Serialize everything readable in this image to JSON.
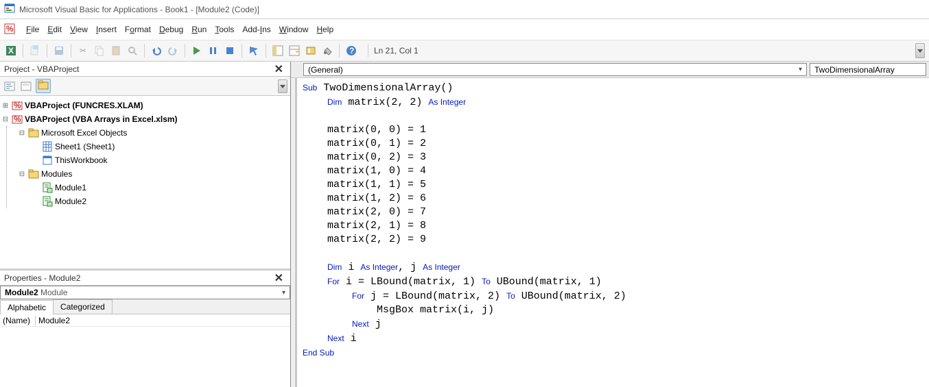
{
  "title": "Microsoft Visual Basic for Applications - Book1 - [Module2 (Code)]",
  "menus": [
    "File",
    "Edit",
    "View",
    "Insert",
    "Format",
    "Debug",
    "Run",
    "Tools",
    "Add-Ins",
    "Window",
    "Help"
  ],
  "menu_mnemonic_index": [
    0,
    0,
    0,
    0,
    1,
    0,
    0,
    0,
    4,
    0,
    0
  ],
  "status": "Ln 21, Col 1",
  "project_panel_title": "Project - VBAProject",
  "tree": {
    "vbaproject1": "VBAProject (FUNCRES.XLAM)",
    "vbaproject2": "VBAProject (VBA Arrays in Excel.xlsm)",
    "excel_objects": "Microsoft Excel Objects",
    "sheet1": "Sheet1 (Sheet1)",
    "thisworkbook": "ThisWorkbook",
    "modules": "Modules",
    "module1": "Module1",
    "module2": "Module2"
  },
  "properties_panel_title": "Properties - Module2",
  "props": {
    "object_selector": "Module2 Module",
    "tabs": [
      "Alphabetic",
      "Categorized"
    ],
    "name_key": "(Name)",
    "name_value": "Module2"
  },
  "code_dropdowns": {
    "object": "(General)",
    "procedure": "TwoDimensionalArray"
  },
  "code_tokens": [
    [
      [
        "kw",
        "Sub"
      ],
      [
        "t",
        " TwoDimensionalArray()"
      ]
    ],
    [
      [
        "t",
        "    "
      ],
      [
        "kw",
        "Dim"
      ],
      [
        "t",
        " matrix(2, 2) "
      ],
      [
        "kw",
        "As Integer"
      ]
    ],
    [],
    [
      [
        "t",
        "    matrix(0, 0) = 1"
      ]
    ],
    [
      [
        "t",
        "    matrix(0, 1) = 2"
      ]
    ],
    [
      [
        "t",
        "    matrix(0, 2) = 3"
      ]
    ],
    [
      [
        "t",
        "    matrix(1, 0) = 4"
      ]
    ],
    [
      [
        "t",
        "    matrix(1, 1) = 5"
      ]
    ],
    [
      [
        "t",
        "    matrix(1, 2) = 6"
      ]
    ],
    [
      [
        "t",
        "    matrix(2, 0) = 7"
      ]
    ],
    [
      [
        "t",
        "    matrix(2, 1) = 8"
      ]
    ],
    [
      [
        "t",
        "    matrix(2, 2) = 9"
      ]
    ],
    [],
    [
      [
        "t",
        "    "
      ],
      [
        "kw",
        "Dim"
      ],
      [
        "t",
        " i "
      ],
      [
        "kw",
        "As Integer"
      ],
      [
        "t",
        ", j "
      ],
      [
        "kw",
        "As Integer"
      ]
    ],
    [
      [
        "t",
        "    "
      ],
      [
        "kw",
        "For"
      ],
      [
        "t",
        " i = LBound(matrix, 1) "
      ],
      [
        "kw",
        "To"
      ],
      [
        "t",
        " UBound(matrix, 1)"
      ]
    ],
    [
      [
        "t",
        "        "
      ],
      [
        "kw",
        "For"
      ],
      [
        "t",
        " j = LBound(matrix, 2) "
      ],
      [
        "kw",
        "To"
      ],
      [
        "t",
        " UBound(matrix, 2)"
      ]
    ],
    [
      [
        "t",
        "            MsgBox matrix(i, j)"
      ]
    ],
    [
      [
        "t",
        "        "
      ],
      [
        "kw",
        "Next"
      ],
      [
        "t",
        " j"
      ]
    ],
    [
      [
        "t",
        "    "
      ],
      [
        "kw",
        "Next"
      ],
      [
        "t",
        " i"
      ]
    ],
    [
      [
        "kw",
        "End Sub"
      ]
    ]
  ]
}
